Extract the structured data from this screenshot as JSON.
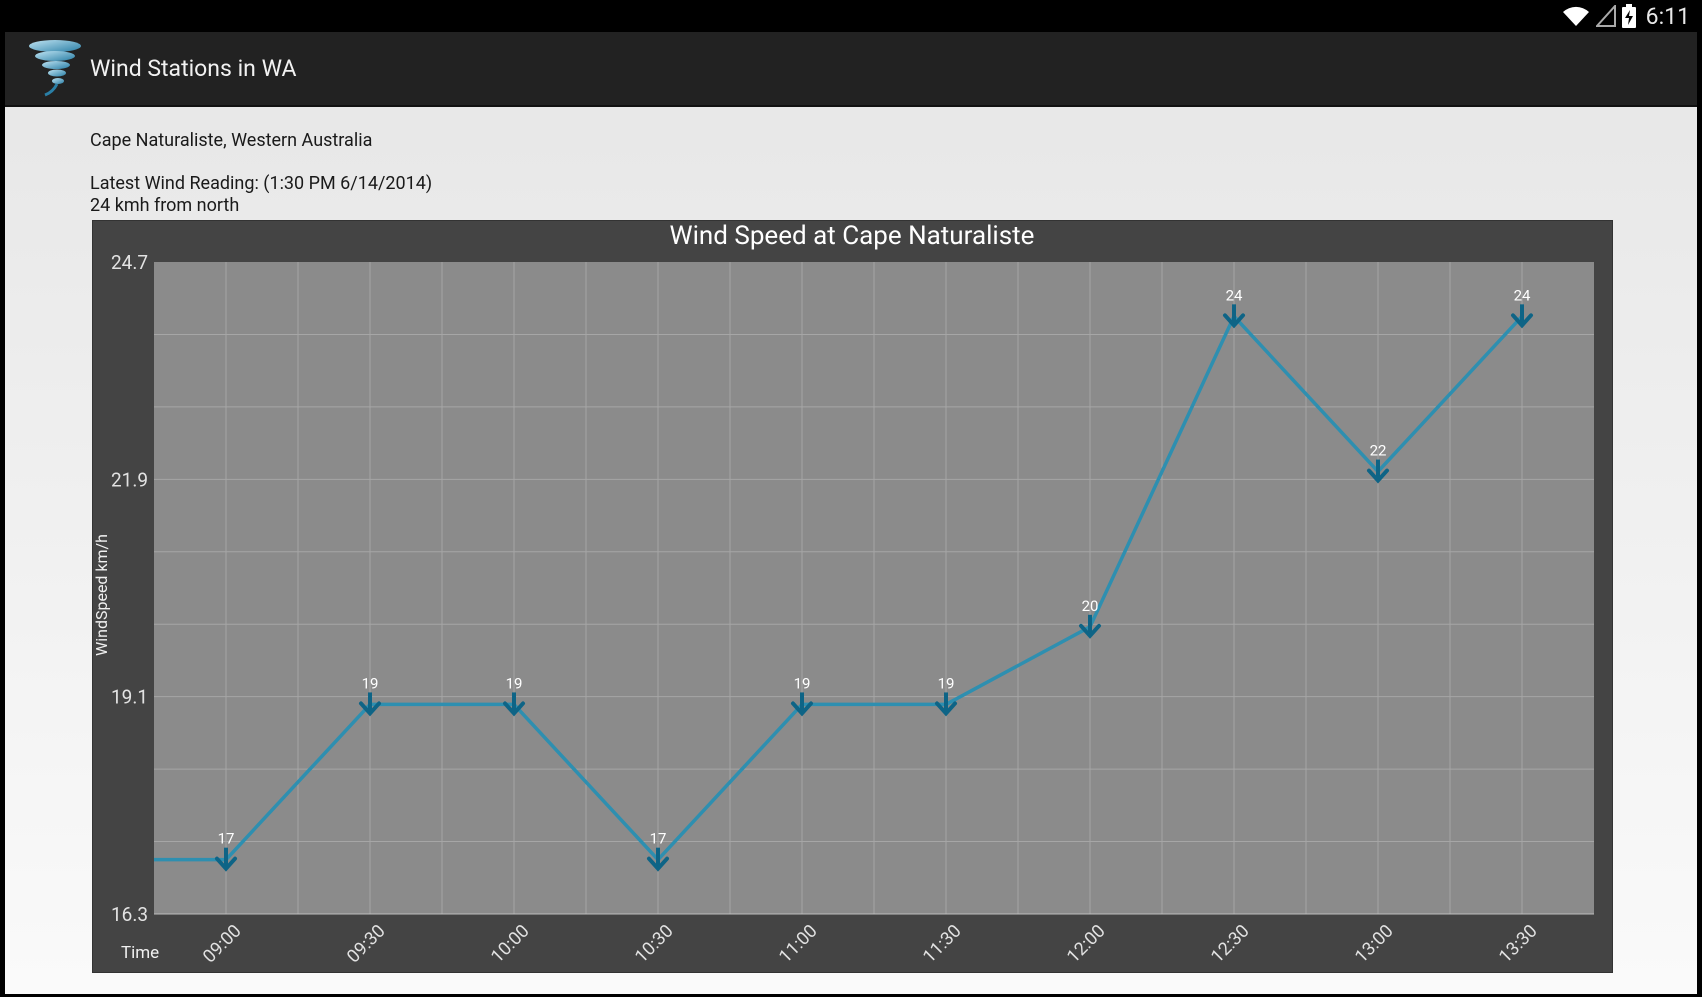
{
  "status_bar": {
    "time": "6:11",
    "icons": [
      "wifi-icon",
      "signal-icon",
      "battery-charging-icon"
    ]
  },
  "app": {
    "title": "Wind Stations in WA",
    "icon": "tornado-icon"
  },
  "station": {
    "location": "Cape Naturaliste, Western Australia",
    "latest_reading": "Latest Wind Reading: (1:30 PM 6/14/2014)",
    "latest_value": "24 kmh from north"
  },
  "colors": {
    "series": "#2e8fb0",
    "marker": "#0e6486",
    "plot_bg": "#8b8b8b",
    "panel_bg": "#444444"
  },
  "chart_data": {
    "type": "line",
    "title": "Wind Speed at Cape Naturaliste",
    "xlabel": "Time",
    "ylabel": "WindSpeed km/h",
    "ylim": [
      16.3,
      24.7
    ],
    "ytick_labels": [
      "24.7",
      "21.9",
      "19.1",
      "16.3"
    ],
    "yticks": [
      24.7,
      21.9,
      19.1,
      16.3
    ],
    "categories": [
      "09:00",
      "09:30",
      "10:00",
      "10:30",
      "11:00",
      "11:30",
      "12:00",
      "12:30",
      "13:00",
      "13:30"
    ],
    "series": [
      {
        "name": "",
        "values": [
          17,
          19,
          19,
          17,
          19,
          19,
          20,
          24,
          22,
          24
        ],
        "point_labels": [
          "17",
          "19",
          "19",
          "17",
          "19",
          "19",
          "20",
          "24",
          "22",
          "24"
        ]
      }
    ],
    "grid": true,
    "marker": "down-arrow"
  }
}
